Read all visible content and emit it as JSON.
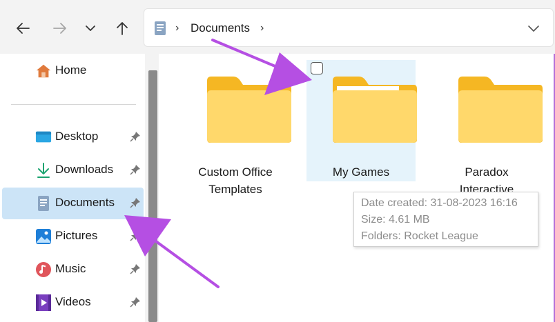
{
  "toolbar": {
    "back_icon": "arrow-left-icon",
    "forward_icon": "arrow-right-icon",
    "recent_icon": "chevron-down-icon",
    "up_icon": "arrow-up-icon"
  },
  "address": {
    "location_icon": "documents-icon",
    "path": "Documents",
    "dropdown_icon": "chevron-down-icon"
  },
  "sidebar": {
    "items": [
      {
        "label": "Home",
        "icon": "home-icon",
        "pinned": false
      },
      {
        "label": "Desktop",
        "icon": "desktop-icon",
        "pinned": true
      },
      {
        "label": "Downloads",
        "icon": "download-icon",
        "pinned": true
      },
      {
        "label": "Documents",
        "icon": "documents-icon",
        "pinned": true,
        "selected": true
      },
      {
        "label": "Pictures",
        "icon": "pictures-icon",
        "pinned": true
      },
      {
        "label": "Music",
        "icon": "music-icon",
        "pinned": true
      },
      {
        "label": "Videos",
        "icon": "videos-icon",
        "pinned": true
      }
    ]
  },
  "folders": [
    {
      "label_line1": "Custom Office",
      "label_line2": "Templates"
    },
    {
      "label_line1": "My Games",
      "label_line2": "",
      "hovered": true
    },
    {
      "label_line1": "Paradox",
      "label_line2": "Interactive"
    }
  ],
  "tooltip": {
    "date_created": "Date created: 31-08-2023 16:16",
    "size": "Size: 4.61 MB",
    "folders": "Folders: Rocket League"
  },
  "colors": {
    "selected_bg": "#cce4f7",
    "hover_bg": "#e5f3fb",
    "annotation_arrow": "#b54fe3",
    "folder_yellow": "#ffd86b"
  }
}
